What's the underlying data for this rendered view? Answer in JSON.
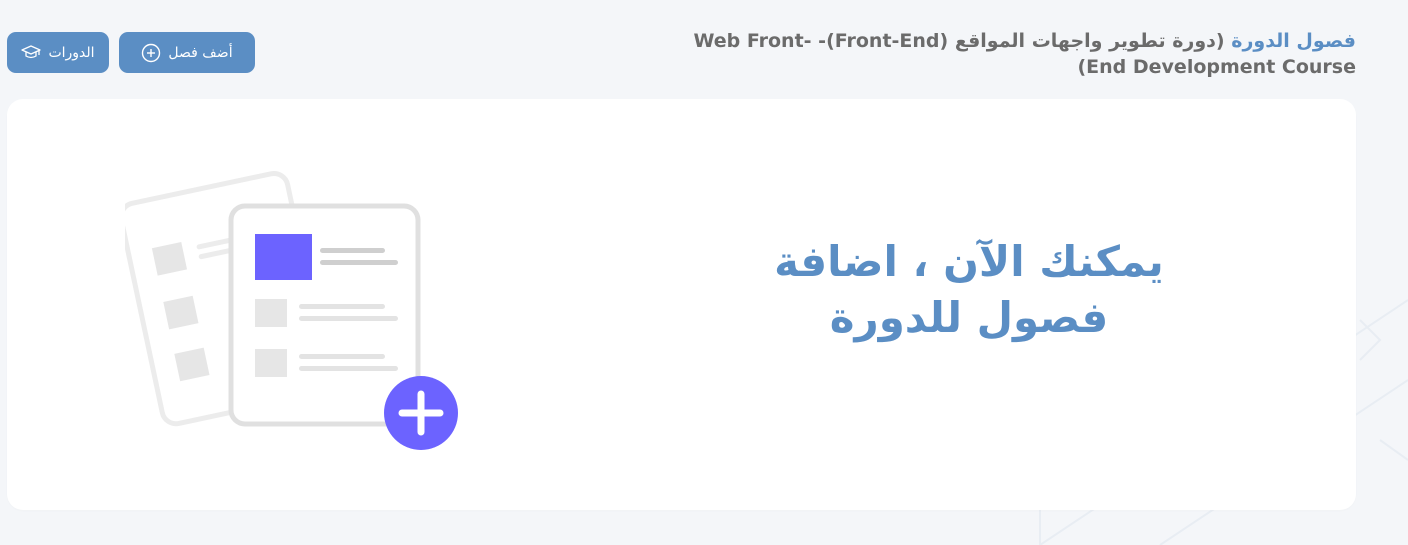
{
  "header": {
    "title_accent": "فصول الدورة",
    "title_rest": " (دورة تطوير واجهات المواقع (Front-End)- Web Front-End Development Course)"
  },
  "buttons": {
    "add_chapter": "أضف فصل",
    "courses": "الدورات"
  },
  "empty_state": {
    "line1": "يمكنك الآن ، اضافة",
    "line2": "فصول للدورة"
  },
  "colors": {
    "accent": "#5b8ec4",
    "illustration_purple": "#6c63ff",
    "background": "#f4f6f9"
  },
  "icons": {
    "add": "plus-circle-icon",
    "courses": "graduation-cap-icon",
    "illustration": "add-document-illustration"
  }
}
